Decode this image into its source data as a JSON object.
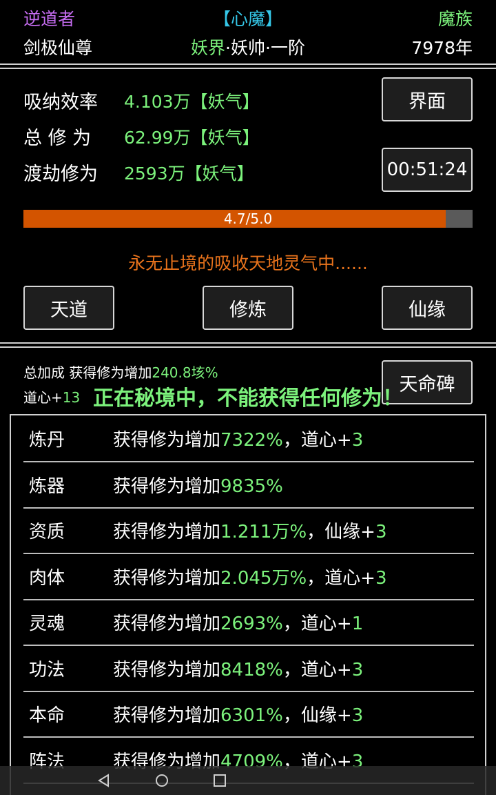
{
  "header": {
    "role": "逆道者",
    "heart_demon": "【心魔】",
    "race": "魔族",
    "title": "剑极仙尊",
    "realm": "妖界",
    "rank": "·妖帅·一阶",
    "years": "7978年"
  },
  "stats": {
    "absorb_rate_label": "吸纳效率",
    "absorb_rate_value": "4.103万【妖气】",
    "total_cultivation_label": "总 修 为",
    "total_cultivation_value": "62.99万【妖气】",
    "tribulation_label": "渡劫修为",
    "tribulation_value": "2593万【妖气】",
    "interface_button": "界面",
    "timer": "00:51:24",
    "progress_text": "4.7/5.0",
    "progress_fraction": 0.94,
    "absorb_message": "永无止境的吸收天地灵气中......"
  },
  "actions": {
    "tiandao": "天道",
    "xiulian": "修炼",
    "xianyuan": "仙缘"
  },
  "bonus": {
    "total_label": "总加成 获得修为增加",
    "total_value": "240.8垓%",
    "daoxin_label": "道心+",
    "daoxin_value": "13",
    "tianming_button": "天命碑",
    "secret_realm_message": "正在秘境中，不能获得任何修为！"
  },
  "bonus_rows": [
    {
      "name": "炼丹",
      "prefix": "获得修为增加",
      "percent": "7322%",
      "extra": "，道心+",
      "extra_value": "3"
    },
    {
      "name": "炼器",
      "prefix": "获得修为增加",
      "percent": "9835%",
      "extra": "",
      "extra_value": ""
    },
    {
      "name": "资质",
      "prefix": "获得修为增加",
      "percent": "1.211万%",
      "extra": "，仙缘+",
      "extra_value": "3"
    },
    {
      "name": "肉体",
      "prefix": "获得修为增加",
      "percent": "2.045万%",
      "extra": "，道心+",
      "extra_value": "3"
    },
    {
      "name": "灵魂",
      "prefix": "获得修为增加",
      "percent": "2693%",
      "extra": "，道心+",
      "extra_value": "1"
    },
    {
      "name": "功法",
      "prefix": "获得修为增加",
      "percent": "8418%",
      "extra": "，道心+",
      "extra_value": "3"
    },
    {
      "name": "本命",
      "prefix": "获得修为增加",
      "percent": "6301%",
      "extra": "，仙缘+",
      "extra_value": "3"
    },
    {
      "name": "阵法",
      "prefix": "获得修为增加",
      "percent": "4709%",
      "extra": "，道心+",
      "extra_value": "3"
    }
  ],
  "colors": {
    "green": "#7cf27c",
    "purple": "#c56cf0",
    "cyan": "#35c7e8",
    "orange": "#e9731c",
    "progress": "#d35400"
  },
  "navbar": {
    "icons": [
      "back-icon",
      "home-icon",
      "recents-icon"
    ]
  }
}
